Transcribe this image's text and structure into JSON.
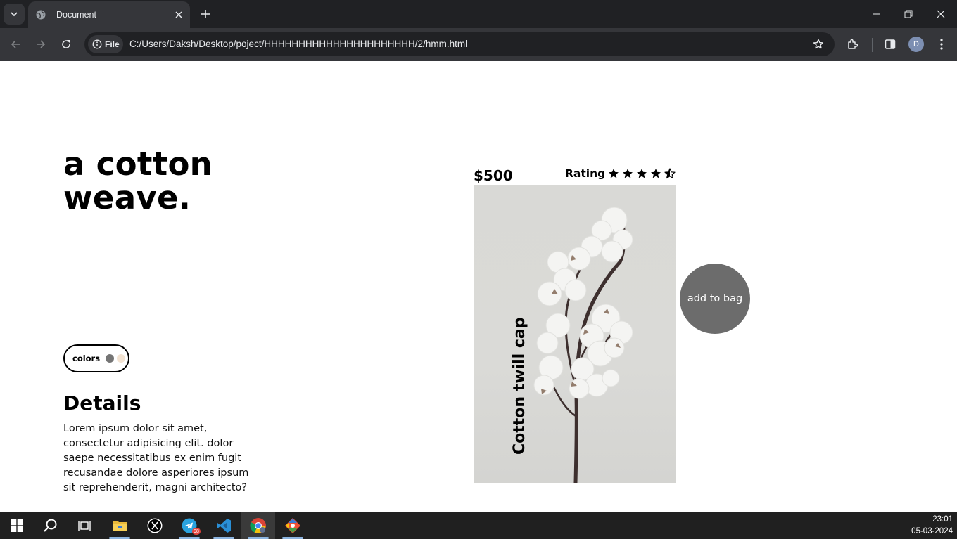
{
  "browser": {
    "tab": {
      "title": "Document"
    },
    "omnibox": {
      "chip_label": "File",
      "url": "C:/Users/Daksh/Desktop/poject/HHHHHHHHHHHHHHHHHHHHHH/2/hmm.html"
    },
    "profile_initial": "D"
  },
  "page": {
    "hero_title_line1": "a cotton",
    "hero_title_line2": "weave.",
    "colors": {
      "label": "colors",
      "swatches": [
        "#757575",
        "#f3e3d2"
      ]
    },
    "details": {
      "heading": "Details",
      "body": "Lorem ipsum dolor sit amet, consectetur adipisicing elit. dolor saepe necessitatibus ex enim fugit recusandae dolore asperiores ipsum sit reprehenderit, magni architecto?"
    },
    "product": {
      "price": "$500",
      "rating_label": "Rating",
      "rating_value": 4.5,
      "rating_max": 5,
      "name": "Cotton twill cap",
      "image_icon": "cotton-branch-image"
    },
    "add_to_bag_label": "add to bag"
  },
  "taskbar": {
    "apps": [
      "start-icon",
      "search-icon",
      "task-view-icon",
      "file-explorer-icon",
      "x-icon",
      "telegram-icon",
      "vscode-icon",
      "chrome-icon",
      "git-icon"
    ],
    "telegram_badge": "98",
    "time": "23:01",
    "date": "05-03-2024"
  },
  "colors": {
    "accent_button": "#6c6c6c",
    "chrome_dark": "#202124",
    "chrome_toolbar": "#35363a"
  }
}
